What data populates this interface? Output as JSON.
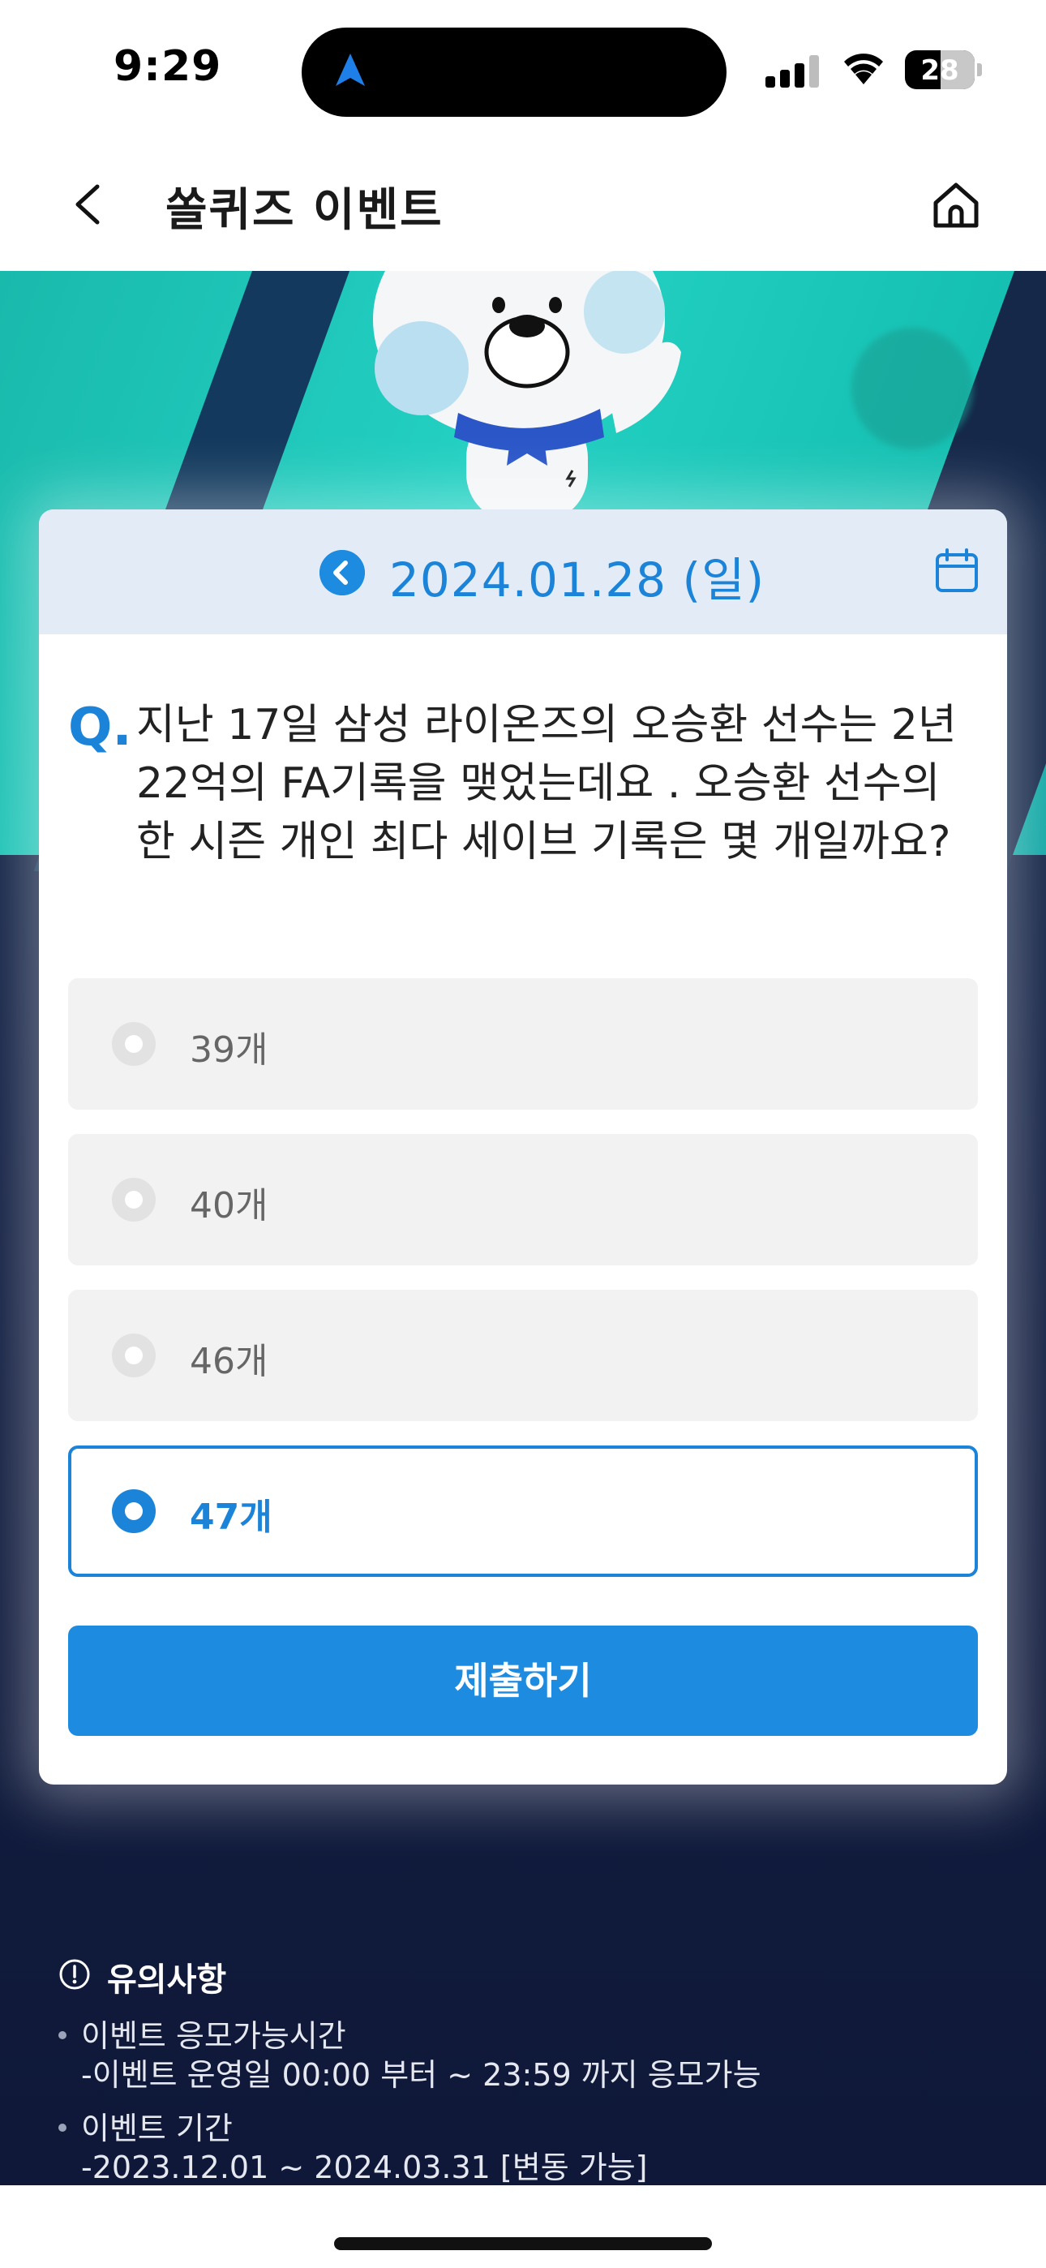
{
  "status_bar": {
    "time": "9:29",
    "battery": "28"
  },
  "header": {
    "title": "쏠퀴즈 이벤트"
  },
  "quiz": {
    "date": "2024.01.28 (일)",
    "q_mark": "Q.",
    "question": "지난 17일 삼성 라이온즈의 오승환 선수는 2년 22억의 FA기록을 맺었는데요 . 오승환 선수의 한 시즌 개인 최다 세이브 기록은 몇 개일까요?",
    "options": [
      {
        "label": "39개",
        "selected": false
      },
      {
        "label": "40개",
        "selected": false
      },
      {
        "label": "46개",
        "selected": false
      },
      {
        "label": "47개",
        "selected": true
      }
    ],
    "submit_label": "제출하기"
  },
  "notice": {
    "title": "유의사항",
    "items": [
      {
        "line1": "이벤트 응모가능시간",
        "line2": "-이벤트 운영일 00:00 부터 ~ 23:59 까지 응모가능"
      },
      {
        "line1": "이벤트 기간",
        "line2": "-2023.12.01 ~ 2024.03.31 [변동 가능]"
      }
    ]
  },
  "colors": {
    "accent": "#1c84d8",
    "teal": "#23d1c3",
    "navy": "#121f43"
  }
}
